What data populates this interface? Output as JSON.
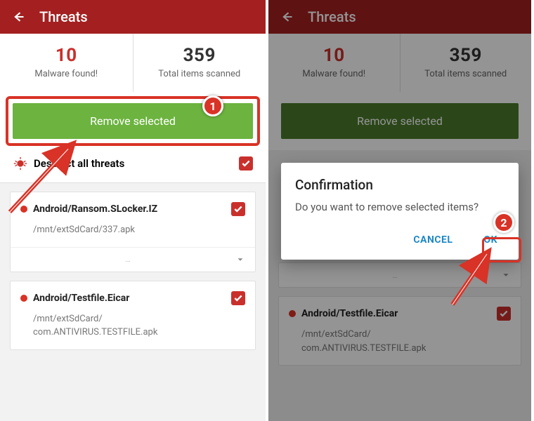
{
  "header": {
    "title": "Threats"
  },
  "stats": {
    "malware_count": "10",
    "malware_label": "Malware found!",
    "scanned_count": "359",
    "scanned_label": "Total items scanned"
  },
  "remove_button": "Remove selected",
  "deselect": {
    "label": "Deselect all threats"
  },
  "threats": [
    {
      "name": "Android/Ransom.SLocker.IZ",
      "path": "/mnt/extSdCard/337.apk"
    },
    {
      "name": "Android/Testfile.Eicar",
      "path": "/mnt/extSdCard/\ncom.ANTIVIRUS.TESTFILE.apk"
    }
  ],
  "dialog": {
    "title": "Confirmation",
    "message": "Do you want to remove selected items?",
    "cancel": "CANCEL",
    "ok": "OK"
  },
  "annotations": {
    "step1": "1",
    "step2": "2"
  }
}
